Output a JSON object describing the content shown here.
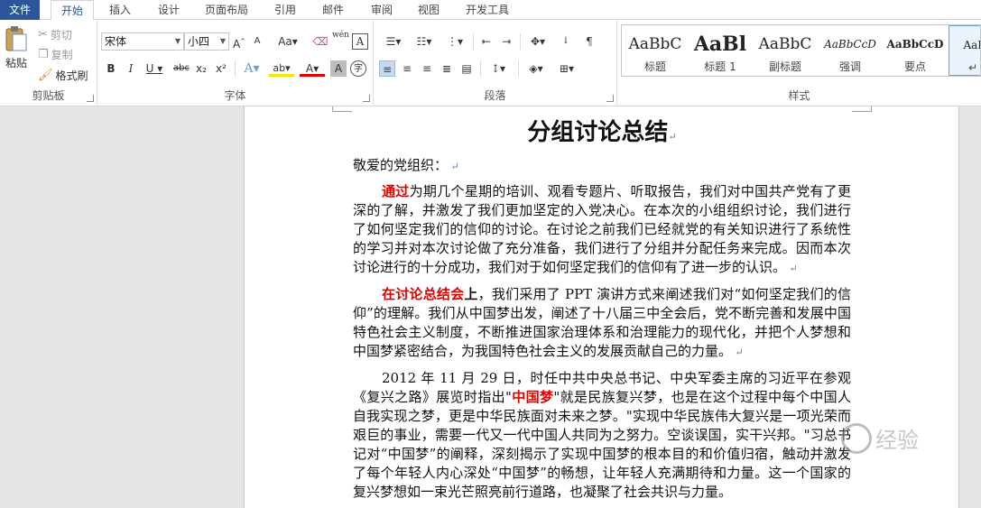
{
  "tabs": [
    "文件",
    "开始",
    "插入",
    "设计",
    "页面布局",
    "引用",
    "邮件",
    "审阅",
    "视图",
    "开发工具"
  ],
  "active_tab": "开始",
  "clipboard": {
    "paste_label": "粘贴",
    "cut_label": "剪切",
    "copy_label": "复制",
    "format_painter_label": "格式刷",
    "group_label": "剪贴板"
  },
  "font": {
    "font_name": "宋体",
    "font_size": "小四",
    "grow_label": "A",
    "shrink_label": "A",
    "case_label": "Aa",
    "bold": "B",
    "italic": "I",
    "underline": "U",
    "strike": "abc",
    "subscript": "x₂",
    "superscript": "x²",
    "phonetic": "wén",
    "border_char": "A",
    "effects": "A",
    "highlight": "ab",
    "font_color": "A",
    "shading": "A",
    "enclose": "字",
    "group_label": "字体"
  },
  "paragraph": {
    "group_label": "段落"
  },
  "styles": {
    "items": [
      {
        "sample": "AaBbC",
        "name": "标题"
      },
      {
        "sample": "AaBl",
        "name": "标题 1"
      },
      {
        "sample": "AaBbC",
        "name": "副标题"
      },
      {
        "sample": "AaBbCcD",
        "name": "强调"
      },
      {
        "sample": "AaBbCcD",
        "name": "要点"
      },
      {
        "sample": "AaBb(",
        "name": "↵ 正"
      }
    ],
    "group_label": "样式"
  },
  "document": {
    "title": "分组讨论总结",
    "salutation": "敬爱的党组织：",
    "p1_lead": "通过",
    "p1_text": "为期几个星期的培训、观看专题片、听取报告，我们对中国共产党有了更深的了解，并激发了我们更加坚定的入党决心。在本次的小组组织讨论，我们进行了如何坚定我们的信仰的讨论。在讨论之前我们已经就党的有关知识进行了系统性的学习并对本次讨论做了充分准备，我们进行了分组并分配任务来完成。因而本次讨论进行的十分成功，我们对于如何坚定我们的信仰有了进一步的认识。",
    "p2_lead": "在讨论总结会",
    "p2_lead2": "上",
    "p2_text": "，我们采用了 PPT 演讲方式来阐述我们对“如何坚定我们的信仰”的理解。我们从中国梦出发，阐述了十八届三中全会后，党不断完善和发展中国特色社会主义制度，不断推进国家治理体系和治理能力的现代化，并把个人梦想和中国梦紧密结合，为我国特色社会主义的发展贡献自己的力量。",
    "p3_pre": "2012 年 11 月 29 日，时任中共中央总书记、中央军委主席的习近平在参观《复兴之路》展览时指出\"",
    "p3_red": "中国梦",
    "p3_text": "\"就是民族复兴梦，也是在这个过程中每个中国人自我实现之梦，更是中华民族面对未来之梦。\"实现中华民族伟大复兴是一项光荣而艰巨的事业，需要一代又一代中国人共同为之努力。空谈误国，实干兴邦。\"习总书记对“中国梦”的阐释，深刻揭示了实现中国梦的根本目的和价值归宿，触动并激发了每个年轻人内心深处“中国梦”的畅想，让年轻人充满期待和力量。这一个国家的复兴梦想如一束光芒照亮前行道路，也凝聚了社会共识与力量。"
  },
  "watermark": {
    "text": "经验"
  }
}
